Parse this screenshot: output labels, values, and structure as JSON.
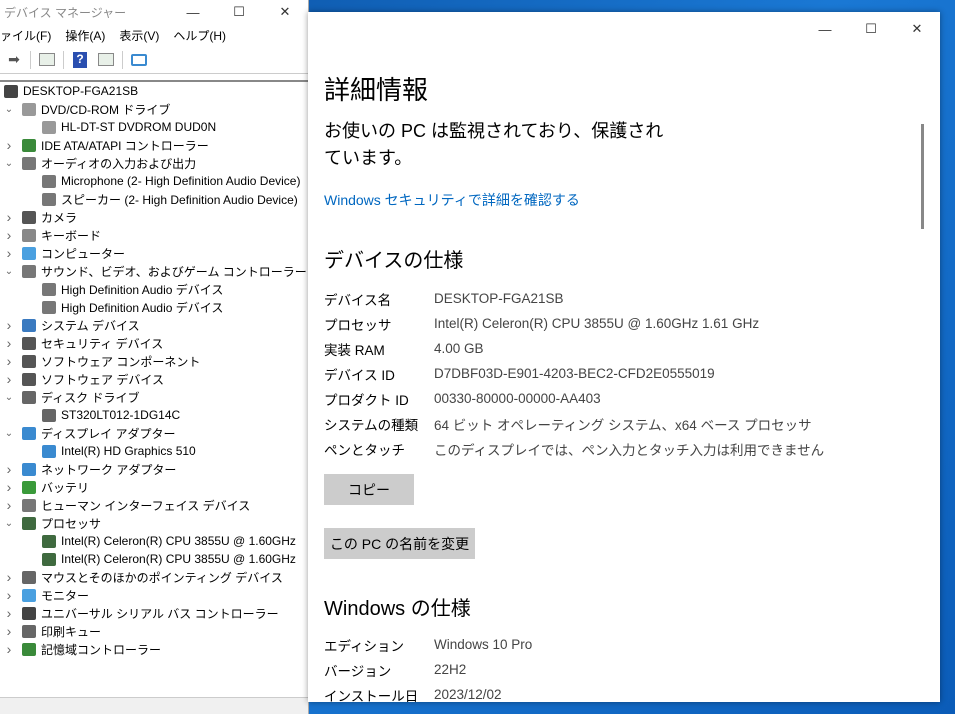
{
  "device_manager": {
    "title": "デバイス マネージャー",
    "menu": [
      "ァイル(F)",
      "操作(A)",
      "表示(V)",
      "ヘルプ(H)"
    ],
    "tree": [
      {
        "level": 0,
        "label": "DESKTOP-FGA21SB",
        "icon": "computer-icon",
        "color": "#444"
      },
      {
        "level": 1,
        "label": "DVD/CD-ROM ドライブ",
        "icon": "dvd-drive-icon",
        "color": "#999",
        "exp": "open"
      },
      {
        "level": 2,
        "label": "HL-DT-ST DVDROM DUD0N",
        "icon": "dvd-drive-icon",
        "color": "#999"
      },
      {
        "level": 1,
        "label": "IDE ATA/ATAPI コントローラー",
        "icon": "ide-controller-icon",
        "color": "#3a8a3a",
        "exp": "closed"
      },
      {
        "level": 1,
        "label": "オーディオの入力および出力",
        "icon": "speaker-icon",
        "color": "#777",
        "exp": "open"
      },
      {
        "level": 2,
        "label": "Microphone (2- High Definition Audio Device)",
        "icon": "microphone-icon",
        "color": "#777"
      },
      {
        "level": 2,
        "label": "スピーカー (2- High Definition Audio Device)",
        "icon": "speaker-icon",
        "color": "#777"
      },
      {
        "level": 1,
        "label": "カメラ",
        "icon": "camera-icon",
        "color": "#555",
        "exp": "closed"
      },
      {
        "level": 1,
        "label": "キーボード",
        "icon": "keyboard-icon",
        "color": "#888",
        "exp": "closed"
      },
      {
        "level": 1,
        "label": "コンピューター",
        "icon": "computer-icon",
        "color": "#4aa0e0",
        "exp": "closed"
      },
      {
        "level": 1,
        "label": "サウンド、ビデオ、およびゲーム コントローラー",
        "icon": "speaker-icon",
        "color": "#777",
        "exp": "open"
      },
      {
        "level": 2,
        "label": "High Definition Audio デバイス",
        "icon": "speaker-icon",
        "color": "#777"
      },
      {
        "level": 2,
        "label": "High Definition Audio デバイス",
        "icon": "speaker-icon",
        "color": "#777"
      },
      {
        "level": 1,
        "label": "システム デバイス",
        "icon": "system-device-icon",
        "color": "#3a7ac0",
        "exp": "closed"
      },
      {
        "level": 1,
        "label": "セキュリティ デバイス",
        "icon": "security-device-icon",
        "color": "#555",
        "exp": "closed"
      },
      {
        "level": 1,
        "label": "ソフトウェア コンポーネント",
        "icon": "software-component-icon",
        "color": "#555",
        "exp": "closed"
      },
      {
        "level": 1,
        "label": "ソフトウェア デバイス",
        "icon": "software-device-icon",
        "color": "#555",
        "exp": "closed"
      },
      {
        "level": 1,
        "label": "ディスク ドライブ",
        "icon": "disk-drive-icon",
        "color": "#666",
        "exp": "open"
      },
      {
        "level": 2,
        "label": "ST320LT012-1DG14C",
        "icon": "disk-drive-icon",
        "color": "#666"
      },
      {
        "level": 1,
        "label": "ディスプレイ アダプター",
        "icon": "display-adapter-icon",
        "color": "#3a8ad0",
        "exp": "open"
      },
      {
        "level": 2,
        "label": "Intel(R) HD Graphics 510",
        "icon": "display-adapter-icon",
        "color": "#3a8ad0"
      },
      {
        "level": 1,
        "label": "ネットワーク アダプター",
        "icon": "network-adapter-icon",
        "color": "#3a8ad0",
        "exp": "closed"
      },
      {
        "level": 1,
        "label": "バッテリ",
        "icon": "battery-icon",
        "color": "#3a9a3a",
        "exp": "closed"
      },
      {
        "level": 1,
        "label": "ヒューマン インターフェイス デバイス",
        "icon": "hid-icon",
        "color": "#777",
        "exp": "closed"
      },
      {
        "level": 1,
        "label": "プロセッサ",
        "icon": "processor-icon",
        "color": "#3f6a3f",
        "exp": "open"
      },
      {
        "level": 2,
        "label": "Intel(R) Celeron(R) CPU 3855U @ 1.60GHz",
        "icon": "processor-icon",
        "color": "#3f6a3f"
      },
      {
        "level": 2,
        "label": "Intel(R) Celeron(R) CPU 3855U @ 1.60GHz",
        "icon": "processor-icon",
        "color": "#3f6a3f"
      },
      {
        "level": 1,
        "label": "マウスとそのほかのポインティング デバイス",
        "icon": "mouse-icon",
        "color": "#666",
        "exp": "closed"
      },
      {
        "level": 1,
        "label": "モニター",
        "icon": "monitor-icon",
        "color": "#4aa0e0",
        "exp": "closed"
      },
      {
        "level": 1,
        "label": "ユニバーサル シリアル バス コントローラー",
        "icon": "usb-icon",
        "color": "#444",
        "exp": "closed"
      },
      {
        "level": 1,
        "label": "印刷キュー",
        "icon": "printer-icon",
        "color": "#666",
        "exp": "closed"
      },
      {
        "level": 1,
        "label": "記憶域コントローラー",
        "icon": "storage-controller-icon",
        "color": "#3a8a3a",
        "exp": "closed"
      }
    ]
  },
  "settings": {
    "heading": "詳細情報",
    "protected_msg": "お使いの PC は監視されており、保護されています。",
    "security_link": "Windows セキュリティで詳細を確認する",
    "device_spec_heading": "デバイスの仕様",
    "device_specs": [
      {
        "k": "デバイス名",
        "v": "DESKTOP-FGA21SB"
      },
      {
        "k": "プロセッサ",
        "v": "Intel(R) Celeron(R) CPU 3855U @ 1.60GHz   1.61 GHz"
      },
      {
        "k": "実装 RAM",
        "v": "4.00 GB"
      },
      {
        "k": "デバイス ID",
        "v": "D7DBF03D-E901-4203-BEC2-CFD2E0555019"
      },
      {
        "k": "プロダクト ID",
        "v": "00330-80000-00000-AA403"
      },
      {
        "k": "システムの種類",
        "v": "64 ビット オペレーティング システム、x64 ベース プロセッサ"
      },
      {
        "k": "ペンとタッチ",
        "v": "このディスプレイでは、ペン入力とタッチ入力は利用できません"
      }
    ],
    "copy_button": "コピー",
    "rename_button": "この PC の名前を変更",
    "windows_spec_heading": "Windows の仕様",
    "windows_specs": [
      {
        "k": "エディション",
        "v": "Windows 10 Pro"
      },
      {
        "k": "バージョン",
        "v": "22H2"
      },
      {
        "k": "インストール日",
        "v": "2023/12/02"
      }
    ]
  }
}
